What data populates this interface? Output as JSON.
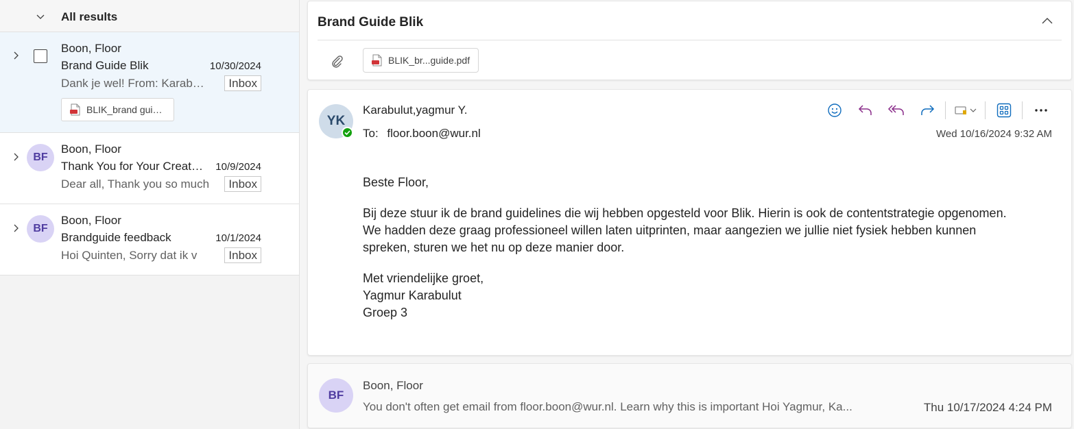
{
  "list": {
    "header_title": "All results",
    "messages": [
      {
        "sender": "Boon, Floor",
        "subject": "Brand Guide Blik",
        "date": "10/30/2024",
        "preview": "Dank je wel! From: Karabulut,yagmur Y.",
        "folder": "Inbox",
        "attachment": "BLIK_brand guidelines.pdf"
      },
      {
        "sender": "Boon, Floor",
        "subject": "Thank You for Your Creative Work",
        "date": "10/9/2024",
        "preview": "Dear all, Thank you so much",
        "folder": "Inbox",
        "initials": "BF"
      },
      {
        "sender": "Boon, Floor",
        "subject": "Brandguide feedback",
        "date": "10/1/2024",
        "preview": "Hoi Quinten, Sorry dat ik v",
        "folder": "Inbox",
        "initials": "BF"
      }
    ]
  },
  "reading": {
    "subject": "Brand Guide Blik",
    "attachment": "BLIK_br...guide.pdf",
    "message": {
      "initials": "YK",
      "from": "Karabulut,yagmur Y.",
      "to_label": "To:",
      "to": "floor.boon@wur.nl",
      "timestamp": "Wed 10/16/2024 9:32 AM",
      "greeting": "Beste Floor,",
      "paragraph": "Bij deze stuur ik de brand guidelines die wij hebben opgesteld voor Blik. Hierin is ook de contentstrategie opgenomen. We hadden deze graag professioneel willen laten uitprinten, maar aangezien we jullie niet fysiek hebben kunnen spreken, sturen we het nu op deze manier door.",
      "closing": "Met vriendelijke groet,",
      "signature_name": "Yagmur Karabulut",
      "signature_group": "Groep 3"
    },
    "reply": {
      "initials": "BF",
      "from": "Boon, Floor",
      "preview": "You don't often get email from floor.boon@wur.nl. Learn why this is important Hoi Yagmur, Ka...",
      "timestamp": "Thu 10/17/2024 4:24 PM"
    }
  },
  "icons": [
    "chevron-down-icon",
    "chevron-right-icon",
    "checkbox-icon",
    "pdf-icon",
    "paperclip-icon",
    "chevron-up-icon",
    "emoji-icon",
    "reply-icon",
    "reply-all-icon",
    "forward-icon",
    "tag-icon",
    "apps-icon",
    "more-icon"
  ],
  "colors": {
    "accent": "#0f6cbd",
    "reply_all": "#8a2d8a",
    "selected_bg": "#eff6fc",
    "avatar_bf_bg": "#d9d3f5",
    "avatar_yk_bg": "#cfdce9",
    "presence": "#13a10e",
    "pdf_red": "#d13438"
  }
}
